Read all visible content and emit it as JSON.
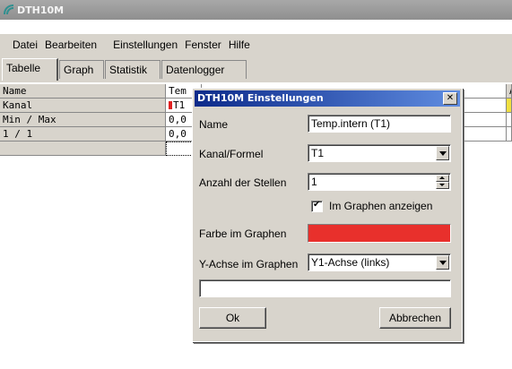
{
  "window": {
    "title": "DTH10M"
  },
  "menu": [
    "Datei",
    "Bearbeiten",
    "Einstellungen",
    "Fenster",
    "Hilfe"
  ],
  "tabs": [
    {
      "label": "Tabelle",
      "active": true
    },
    {
      "label": "Graph",
      "active": false
    },
    {
      "label": "Statistik",
      "active": false
    },
    {
      "label": "Datenlogger",
      "active": false
    }
  ],
  "table": {
    "rows": [
      {
        "header": "Name",
        "value": "Tem"
      },
      {
        "header": "Kanal",
        "value": "T1"
      },
      {
        "header": "Min / Max",
        "value": "0,0"
      },
      {
        "header": "1 / 1",
        "value": "0,0"
      }
    ],
    "right_col": [
      "A",
      "",
      "(",
      "("
    ]
  },
  "dialog": {
    "title": "DTH10M Einstellungen",
    "close_label": "✕",
    "name_label": "Name",
    "name_value": "Temp.intern (T1)",
    "kanal_label": "Kanal/Formel",
    "kanal_value": "T1",
    "stellen_label": "Anzahl der Stellen",
    "stellen_value": "1",
    "show_in_graph_label": "Im Graphen anzeigen",
    "show_in_graph_checked": true,
    "color_label": "Farbe im Graphen",
    "color_value": "#e8302c",
    "yaxis_label": "Y-Achse im Graphen",
    "yaxis_value": "Y1-Achse (links)",
    "formula_value": "",
    "ok_label": "Ok",
    "cancel_label": "Abbrechen"
  },
  "colors": {
    "dialog_title_start": "#0c2a8a",
    "dialog_title_end": "#5f8ce0",
    "window_title": "#9a9a9a",
    "marker_red": "#e02020"
  }
}
